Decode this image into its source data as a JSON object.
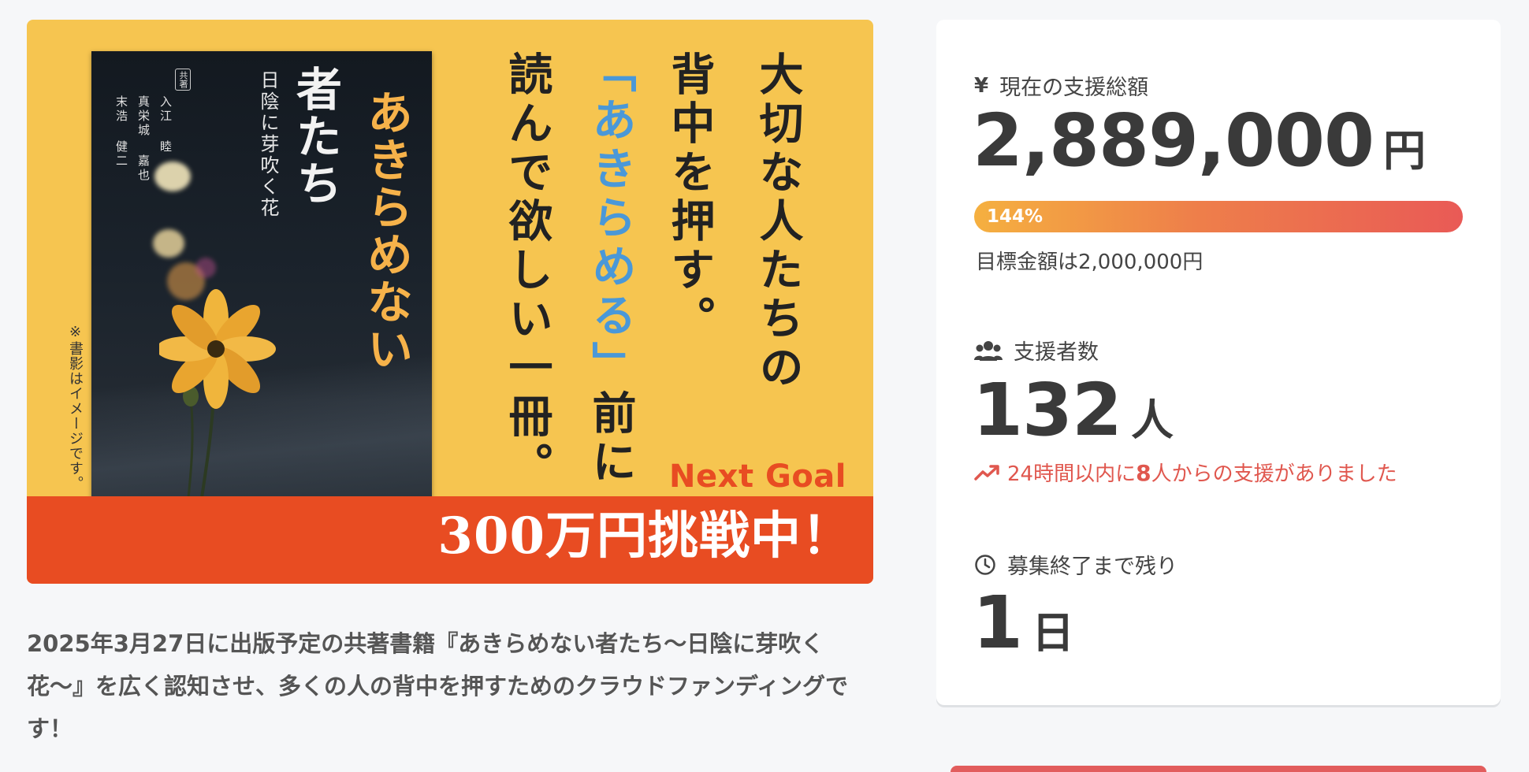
{
  "hero": {
    "headline_col1": "大切な人たちの",
    "headline_col2": "背中を押す。",
    "headline_col3_accent": "「あきらめる」",
    "headline_col3_rest": "前に",
    "headline_col4": "読んで欲しい一冊。",
    "next_goal": "Next Goal",
    "band_text": "300万円挑戦中！",
    "note": "※書影はイメージです。",
    "cover": {
      "title_main": "あきらめない",
      "title_sub": "者たち",
      "subtitle": "日陰に芽吹く花",
      "authors_label": "共著",
      "authors": [
        "入江 睦",
        "真栄城 嘉也",
        "末浩 健二"
      ]
    }
  },
  "description": "2025年3月27日に出版予定の共著書籍『あきらめない者たち〜日陰に芽吹く花〜』を広く認知させ、多くの人の背中を押すためのクラウドファンディングです！",
  "stats": {
    "total": {
      "label": "現在の支援総額",
      "icon": "yen-icon",
      "amount": "2,889,000",
      "unit": "円"
    },
    "progress": {
      "percent_label": "144%",
      "value": 1.44
    },
    "goal_text": "目標金額は2,000,000円",
    "supporters": {
      "label": "支援者数",
      "icon": "users-icon",
      "count": "132",
      "unit": "人"
    },
    "recent": {
      "icon": "trending-up-icon",
      "prefix": "24時間以内に",
      "count": "8",
      "suffix": "人からの支援がありました"
    },
    "remaining": {
      "label": "募集終了まで残り",
      "icon": "clock-icon",
      "value": "1",
      "unit": "日"
    }
  },
  "colors": {
    "banner_yellow": "#f6c550",
    "banner_red": "#e84c22",
    "accent_blue": "#4a98d8",
    "trend_red": "#e0574e",
    "progress_start": "#f5b040",
    "progress_end": "#e95a56"
  }
}
